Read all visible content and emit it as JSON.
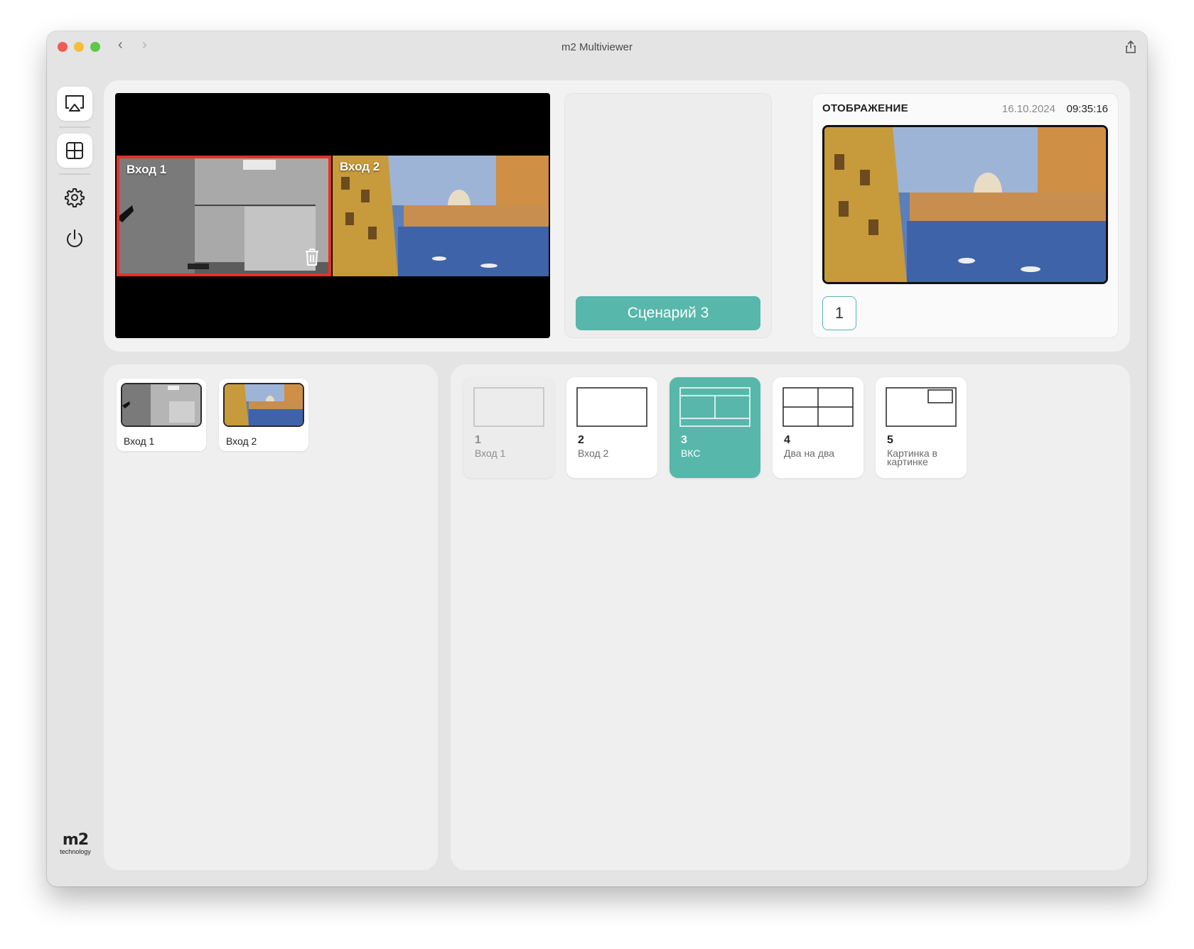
{
  "window": {
    "title": "m2 Multiviewer"
  },
  "sidebar": {
    "items": [
      {
        "icon": "airplay-icon"
      },
      {
        "icon": "grid-icon"
      },
      {
        "icon": "gear-icon"
      },
      {
        "icon": "power-icon"
      }
    ],
    "logo_mark": "m2",
    "logo_text": "technology"
  },
  "preview": {
    "cells": [
      {
        "label": "Вход 1",
        "selected": true
      },
      {
        "label": "Вход 2",
        "selected": false
      }
    ]
  },
  "scenario": {
    "button_label": "Сценарий 3"
  },
  "display": {
    "title": "ОТОБРАЖЕНИЕ",
    "date": "16.10.2024",
    "time": "09:35:16",
    "number": "1"
  },
  "inputs": [
    {
      "label": "Вход 1"
    },
    {
      "label": "Вход 2"
    }
  ],
  "layouts": [
    {
      "num": "1",
      "name": "Вход 1",
      "state": "disabled"
    },
    {
      "num": "2",
      "name": "Вход 2",
      "state": "normal"
    },
    {
      "num": "3",
      "name": "ВКС",
      "state": "active"
    },
    {
      "num": "4",
      "name": "Два на два",
      "state": "normal"
    },
    {
      "num": "5",
      "name": "Картинка в картинке",
      "state": "normal"
    }
  ],
  "colors": {
    "accent": "#57b7ab",
    "selection": "#e0332a",
    "panel": "#efefef"
  }
}
